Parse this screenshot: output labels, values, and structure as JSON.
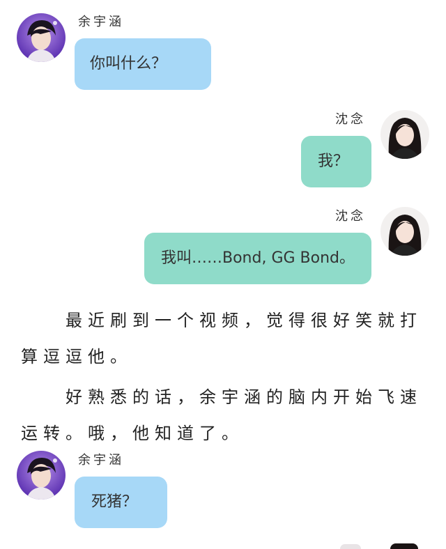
{
  "messages": [
    {
      "sender": "余宇涵",
      "text": "你叫什么？",
      "side": "left"
    },
    {
      "sender": "沈念",
      "text": "我？",
      "side": "right"
    },
    {
      "sender": "沈念",
      "text": "我叫……Bond, GG Bond。",
      "side": "right"
    },
    {
      "sender": "余宇涵",
      "text": "死猪？",
      "side": "left"
    }
  ],
  "narration": [
    "　　最近刷到一个视频，觉得很好笑就打算逗逗他。",
    "　　好熟悉的话，余宇涵的脑内开始飞速运转。哦，他知道了。"
  ],
  "colors": {
    "left_bubble": "#a7d8f7",
    "right_bubble": "#8fdbc9"
  },
  "icons": {
    "male_avatar": "male-avatar-icon",
    "female_avatar": "female-avatar-icon"
  }
}
